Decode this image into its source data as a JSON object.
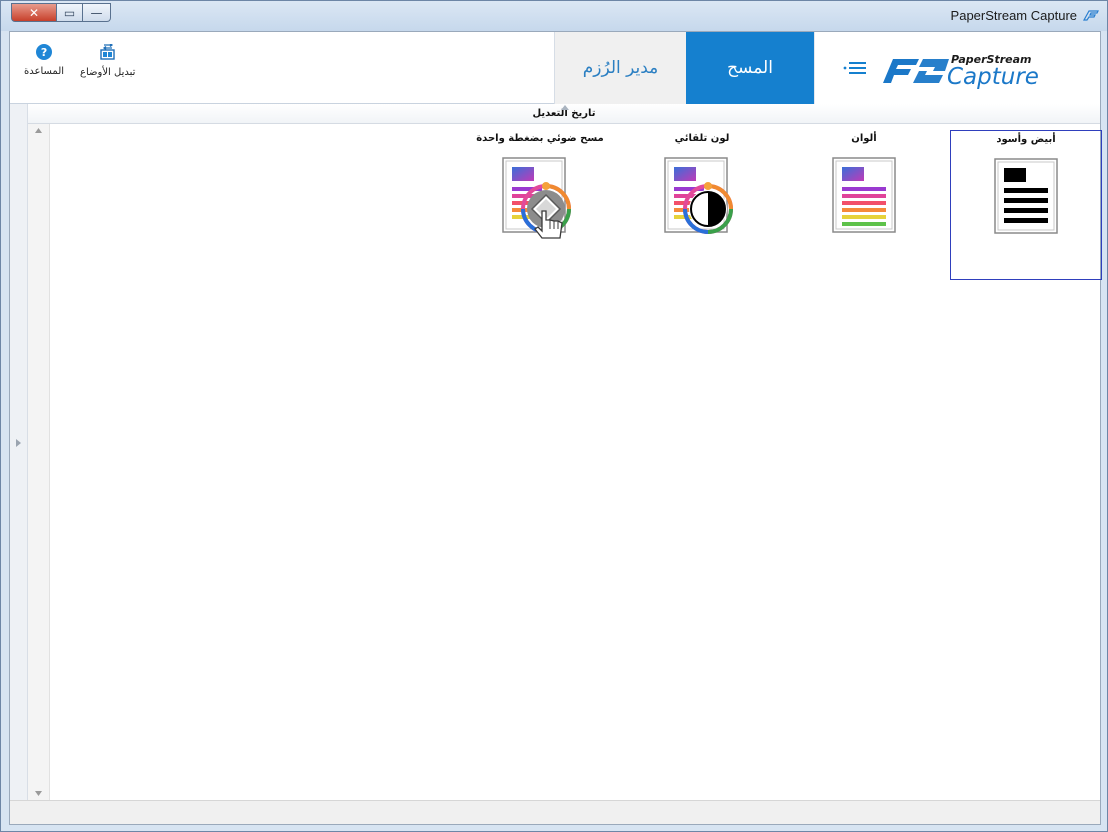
{
  "window": {
    "title": "PaperStream Capture",
    "caption": {
      "close": "✕",
      "maximize": "▭",
      "minimize": "—"
    }
  },
  "toolbar": {
    "help_label": "المساعدة",
    "switch_modes_label": "تبديل الأوضاع"
  },
  "tabs": [
    {
      "label": "مدير الرُزم",
      "active": false
    },
    {
      "label": "المسح",
      "active": true
    }
  ],
  "brand": {
    "logo_top": "PaperStream",
    "logo_main": "Capture",
    "menu_icon": "hamburger-menu-icon"
  },
  "list": {
    "sort_header": "تاريخ التعديل",
    "sort_indicator": "sort-ascending-icon"
  },
  "profiles": [
    {
      "name": "أبيض وأسود",
      "icon": "black-white-document-icon",
      "selected": true
    },
    {
      "name": "ألوان",
      "icon": "color-document-icon",
      "selected": false
    },
    {
      "name": "لون تلقائي",
      "icon": "auto-color-document-icon",
      "selected": false
    },
    {
      "name": "مسح ضوئي بضغطة واحدة",
      "icon": "one-touch-scan-icon",
      "selected": false
    }
  ],
  "colors": {
    "accent": "#1580cf",
    "selection_border": "#2f3fbd",
    "batch_tab_text": "#2b7fc2"
  }
}
